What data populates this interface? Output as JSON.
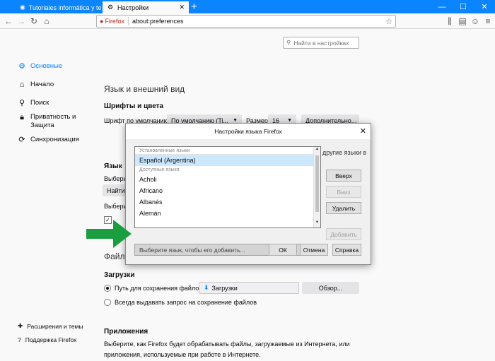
{
  "tabs": [
    {
      "title": "Tutoriales informática y tecno",
      "icon": "site-icon"
    },
    {
      "title": "Настройки",
      "icon": "gear-icon"
    }
  ],
  "navbar": {
    "identity_label": "Firefox",
    "url": "about:preferences"
  },
  "search": {
    "placeholder": "Найти в настройках"
  },
  "sidebar": {
    "items": [
      {
        "label": "Основные",
        "icon": "gear-icon"
      },
      {
        "label": "Начало",
        "icon": "home-icon"
      },
      {
        "label": "Поиск",
        "icon": "search-icon"
      },
      {
        "label": "Приватность и Защита",
        "icon": "lock-icon"
      },
      {
        "label": "Синхронизация",
        "icon": "sync-icon"
      }
    ],
    "footer": [
      {
        "label": "Расширения и темы",
        "icon": "puzzle-icon"
      },
      {
        "label": "Поддержка Firefox",
        "icon": "help-icon"
      }
    ]
  },
  "main": {
    "section_title": "Язык и внешний вид",
    "fonts_heading": "Шрифты и цвета",
    "default_font_label": "Шрифт по умолчанию",
    "default_font_value": "По умолчанию (Ti...",
    "size_label": "Размер",
    "size_value": "16",
    "advanced_button": "Дополнительно...",
    "language_heading": "Язык",
    "choose_partial_1": "Выбери",
    "find_partial": "Найти",
    "choose_partial_2": "Выбери",
    "files_partial": "Файлы",
    "other_lang_partial": "другие языки в",
    "downloads_heading": "Загрузки",
    "save_path_label": "Путь для сохранения файлов",
    "download_folder": "Загрузки",
    "browse_button": "Обзор...",
    "always_ask_label": "Всегда выдавать запрос на сохранение файлов",
    "apps_heading": "Приложения",
    "apps_text_1": "Выберите, как Firefox будет обрабатывать файлы, загружаемые из Интернета, или",
    "apps_text_2": "приложения, используемые при работе в Интернете."
  },
  "dialog": {
    "title": "Настройки языка Firefox",
    "installed_header": "Установленные языки",
    "installed": [
      "Español (Argentina)"
    ],
    "available_header": "Доступные языки",
    "available": [
      "Acholi",
      "Africano",
      "Albanés",
      "Alemán"
    ],
    "select_placeholder": "Выберите язык, чтобы его добавить...",
    "buttons": {
      "up": "Вверх",
      "down": "Вниз",
      "remove": "Удалить",
      "add": "Добавить",
      "ok": "ОК",
      "cancel": "Отмена",
      "help": "Справка"
    }
  },
  "colors": {
    "tabbar": "#0a84ff",
    "accent": "#0a84ff",
    "arrow": "#1a9e3f"
  }
}
